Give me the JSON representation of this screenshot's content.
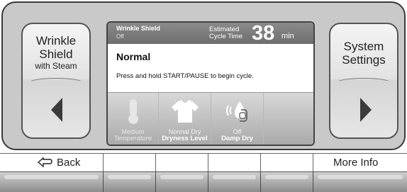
{
  "left_button": {
    "label_line1": "Wrinkle",
    "label_line2": "Shield",
    "label_sub": "with Steam",
    "arrow_icon": "left-arrow-icon"
  },
  "right_button": {
    "label_line1": "System",
    "label_line2": "Settings",
    "arrow_icon": "right-arrow-icon"
  },
  "screen": {
    "wrinkle_shield_title": "Wrinkle Shield",
    "wrinkle_shield_value": "Off",
    "estimated_line1": "Estimated",
    "estimated_line2": "Cycle Time",
    "cycle_time_value": "38",
    "cycle_time_unit": "min",
    "cycle_name": "Normal",
    "instruction": "Press and hold START/PAUSE to begin cycle.",
    "options": [
      {
        "value": "Medium",
        "label": "Temperature",
        "icon": "thermometer-icon"
      },
      {
        "value": "Normal Dry",
        "label": "Dryness Level",
        "icon": "shirt-icon"
      },
      {
        "value": "Off",
        "label": "Damp Dry",
        "icon": "damp-dry-alert-icon"
      }
    ]
  },
  "footer": {
    "back_label": "Back",
    "back_icon": "back-arrow-icon",
    "more_info_label": "More Info"
  },
  "colors": {
    "panel": "#c9c9c9",
    "status_bar": "#7a7a7a",
    "option_row": "#bdbdbd"
  }
}
